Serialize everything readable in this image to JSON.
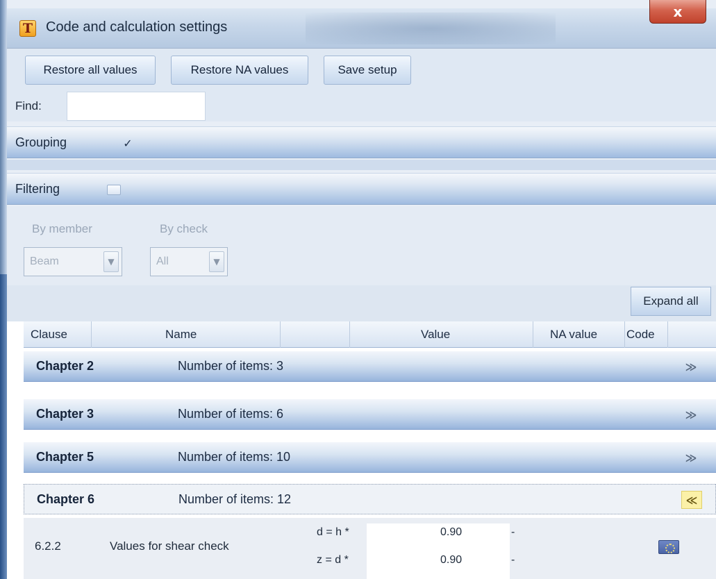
{
  "window": {
    "title": "Code and calculation settings",
    "app_icon_letter": "T",
    "close_label": "x"
  },
  "toolbar": {
    "restore_all": "Restore all values",
    "restore_na": "Restore NA values",
    "save_setup": "Save setup",
    "find_label": "Find:",
    "find_value": ""
  },
  "grouping": {
    "label": "Grouping",
    "checked_mark": "✓"
  },
  "filtering": {
    "label": "Filtering",
    "by_member_label": "By member",
    "by_member_value": "Beam",
    "by_check_label": "By check",
    "by_check_value": "All"
  },
  "expand_all": "Expand all",
  "columns": [
    "Clause",
    "Name",
    "Value",
    "NA value",
    "Code"
  ],
  "chapters": [
    {
      "name": "Chapter 2",
      "count": "Number of items: 3",
      "chevron": "≫"
    },
    {
      "name": "Chapter 3",
      "count": "Number of items: 6",
      "chevron": "≫"
    },
    {
      "name": "Chapter 5",
      "count": "Number of items: 10",
      "chevron": "≫"
    },
    {
      "name": "Chapter 6",
      "count": "Number of items: 12",
      "chevron": "≪"
    }
  ],
  "detail": {
    "clause": "6.2.2",
    "name": "Values for shear check",
    "rows": [
      {
        "symbol": "d = h *",
        "value": "0.90",
        "unit": "-"
      },
      {
        "symbol": "z = d *",
        "value": "0.90",
        "unit": "-"
      }
    ]
  },
  "colors": {
    "header_gradient_end": "#97b4dc",
    "close_button": "#c0422c",
    "open_chevron_bg": "#fbf1a8"
  }
}
